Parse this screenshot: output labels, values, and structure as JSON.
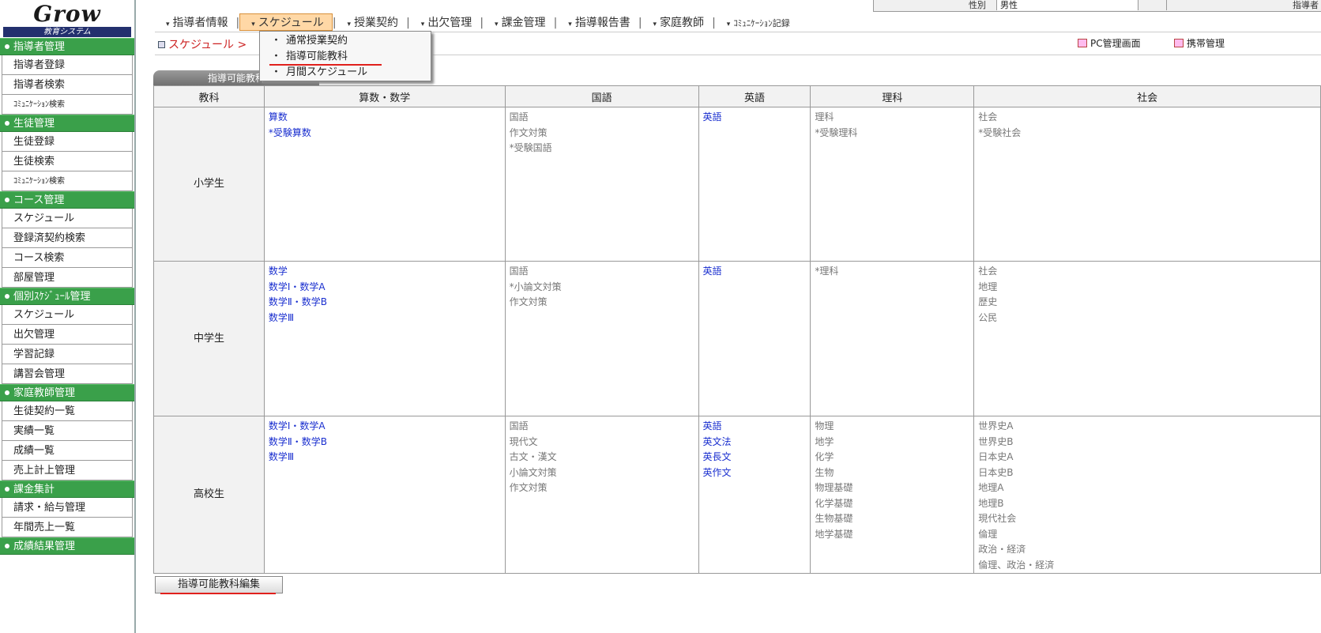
{
  "sidebar": {
    "logo": "Grow",
    "logo_sub": "教育システム",
    "sections": [
      {
        "title": "指導者管理",
        "items": [
          "指導者登録",
          "指導者検索",
          "ｺﾐｭﾆｹｰｼｮﾝ検索"
        ]
      },
      {
        "title": "生徒管理",
        "items": [
          "生徒登録",
          "生徒検索",
          "ｺﾐｭﾆｹｰｼｮﾝ検索"
        ]
      },
      {
        "title": "コース管理",
        "items": [
          "スケジュール",
          "登録済契約検索",
          "コース検索",
          "部屋管理"
        ]
      },
      {
        "title": "個別ｽｹｼﾞｭｰﾙ管理",
        "items": [
          "スケジュール",
          "出欠管理",
          "学習記録",
          "講習会管理"
        ]
      },
      {
        "title": "家庭教師管理",
        "items": [
          "生徒契約一覧",
          "実績一覧",
          "成績一覧",
          "売上計上管理"
        ]
      },
      {
        "title": "課金集計",
        "items": [
          "請求・給与管理",
          "年間売上一覧"
        ]
      },
      {
        "title": "成績結果管理",
        "items": []
      }
    ]
  },
  "topstrip": {
    "label": "性別",
    "value": "男性",
    "right": "指導者"
  },
  "nav": {
    "items": [
      "指導者情報",
      "スケジュール",
      "授業契約",
      "出欠管理",
      "課金管理",
      "指導報告書",
      "家庭教師",
      "ｺﾐｭﾆｹｰｼｮﾝ記録"
    ],
    "active_index": 1
  },
  "dropdown": {
    "items": [
      "通常授業契約",
      "指導可能教科",
      "月間スケジュール"
    ]
  },
  "breadcrumb": {
    "text": "スケジュール >"
  },
  "links": {
    "pc": "PC管理画面",
    "mobile": "携帯管理"
  },
  "table": {
    "tab_label": "指導可能教科",
    "corner": "教科",
    "columns": [
      "算数・数学",
      "国語",
      "英語",
      "理科",
      "社会"
    ],
    "rows": [
      {
        "label": "小学生",
        "cells": [
          {
            "blue": [
              "算数",
              "*受験算数"
            ],
            "gray": []
          },
          {
            "blue": [],
            "gray": [
              "国語",
              "作文対策",
              "*受験国語"
            ]
          },
          {
            "blue": [
              "英語"
            ],
            "gray": []
          },
          {
            "blue": [],
            "gray": [
              "理科",
              "*受験理科"
            ]
          },
          {
            "blue": [],
            "gray": [
              "社会",
              "*受験社会"
            ]
          }
        ]
      },
      {
        "label": "中学生",
        "cells": [
          {
            "blue": [
              "数学",
              "数学Ⅰ・数学A",
              "数学Ⅱ・数学B",
              "数学Ⅲ"
            ],
            "gray": []
          },
          {
            "blue": [],
            "gray": [
              "国語",
              "*小論文対策",
              "作文対策"
            ]
          },
          {
            "blue": [
              "英語"
            ],
            "gray": []
          },
          {
            "blue": [],
            "gray": [
              "*理科"
            ]
          },
          {
            "blue": [],
            "gray": [
              "社会",
              "地理",
              "歴史",
              "公民"
            ]
          }
        ]
      },
      {
        "label": "高校生",
        "cells": [
          {
            "blue": [
              "数学Ⅰ・数学A",
              "数学Ⅱ・数学B",
              "数学Ⅲ"
            ],
            "gray": []
          },
          {
            "blue": [],
            "gray": [
              "国語",
              "現代文",
              "古文・漢文",
              "小論文対策",
              "作文対策"
            ]
          },
          {
            "blue": [
              "英語",
              "英文法",
              "英長文",
              "英作文"
            ],
            "gray": []
          },
          {
            "blue": [],
            "gray": [
              "物理",
              "地学",
              "化学",
              "生物",
              "物理基礎",
              "化学基礎",
              "生物基礎",
              "地学基礎"
            ]
          },
          {
            "blue": [],
            "gray": [
              "世界史A",
              "世界史B",
              "日本史A",
              "日本史B",
              "地理A",
              "地理B",
              "現代社会",
              "倫理",
              "政治・経済",
              "倫理、政治・経済"
            ]
          }
        ]
      }
    ]
  },
  "edit_button": "指導可能教科編集"
}
